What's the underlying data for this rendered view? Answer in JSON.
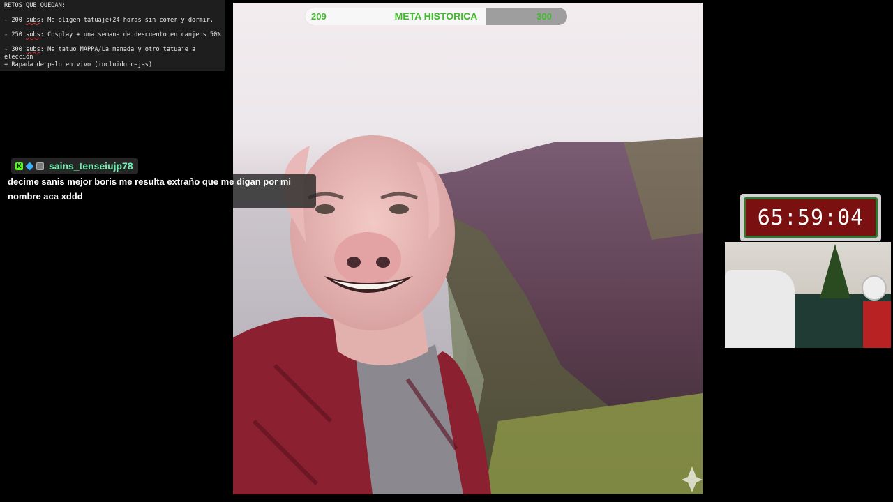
{
  "retos": {
    "title": "RETOS QUE QUEDAN:",
    "items": [
      {
        "prefix": "- 200 ",
        "marked": "subs",
        "rest": ": Me eligen tatuaje+24 horas sin comer y dormir."
      },
      {
        "prefix": "- 250 ",
        "marked": "subs",
        "rest": ": Cosplay + una semana de descuento en canjeos 50%"
      },
      {
        "prefix": "- 300 ",
        "marked": "subs",
        "rest": ": Me tatuo MAPPA/La manada y otro tatuaje a elección\n+ Rapada de pelo en vivo (incluido cejas)"
      }
    ]
  },
  "meta": {
    "current": "209",
    "title": "META HISTORICA",
    "goal": "300",
    "progress_fraction": 0.69
  },
  "chat": {
    "username": "sains_tenseiujp78",
    "message": "decime sanis mejor boris me resulta extraño que me digan por mi nombre aca xddd",
    "badges": [
      "kick-badge-icon",
      "gem-badge-icon",
      "box-badge-icon"
    ]
  },
  "timer": {
    "value": "65:59:04"
  },
  "colors": {
    "accent_green": "#3fba2a",
    "username": "#75f0b0",
    "timer_bg": "#7a1010"
  }
}
